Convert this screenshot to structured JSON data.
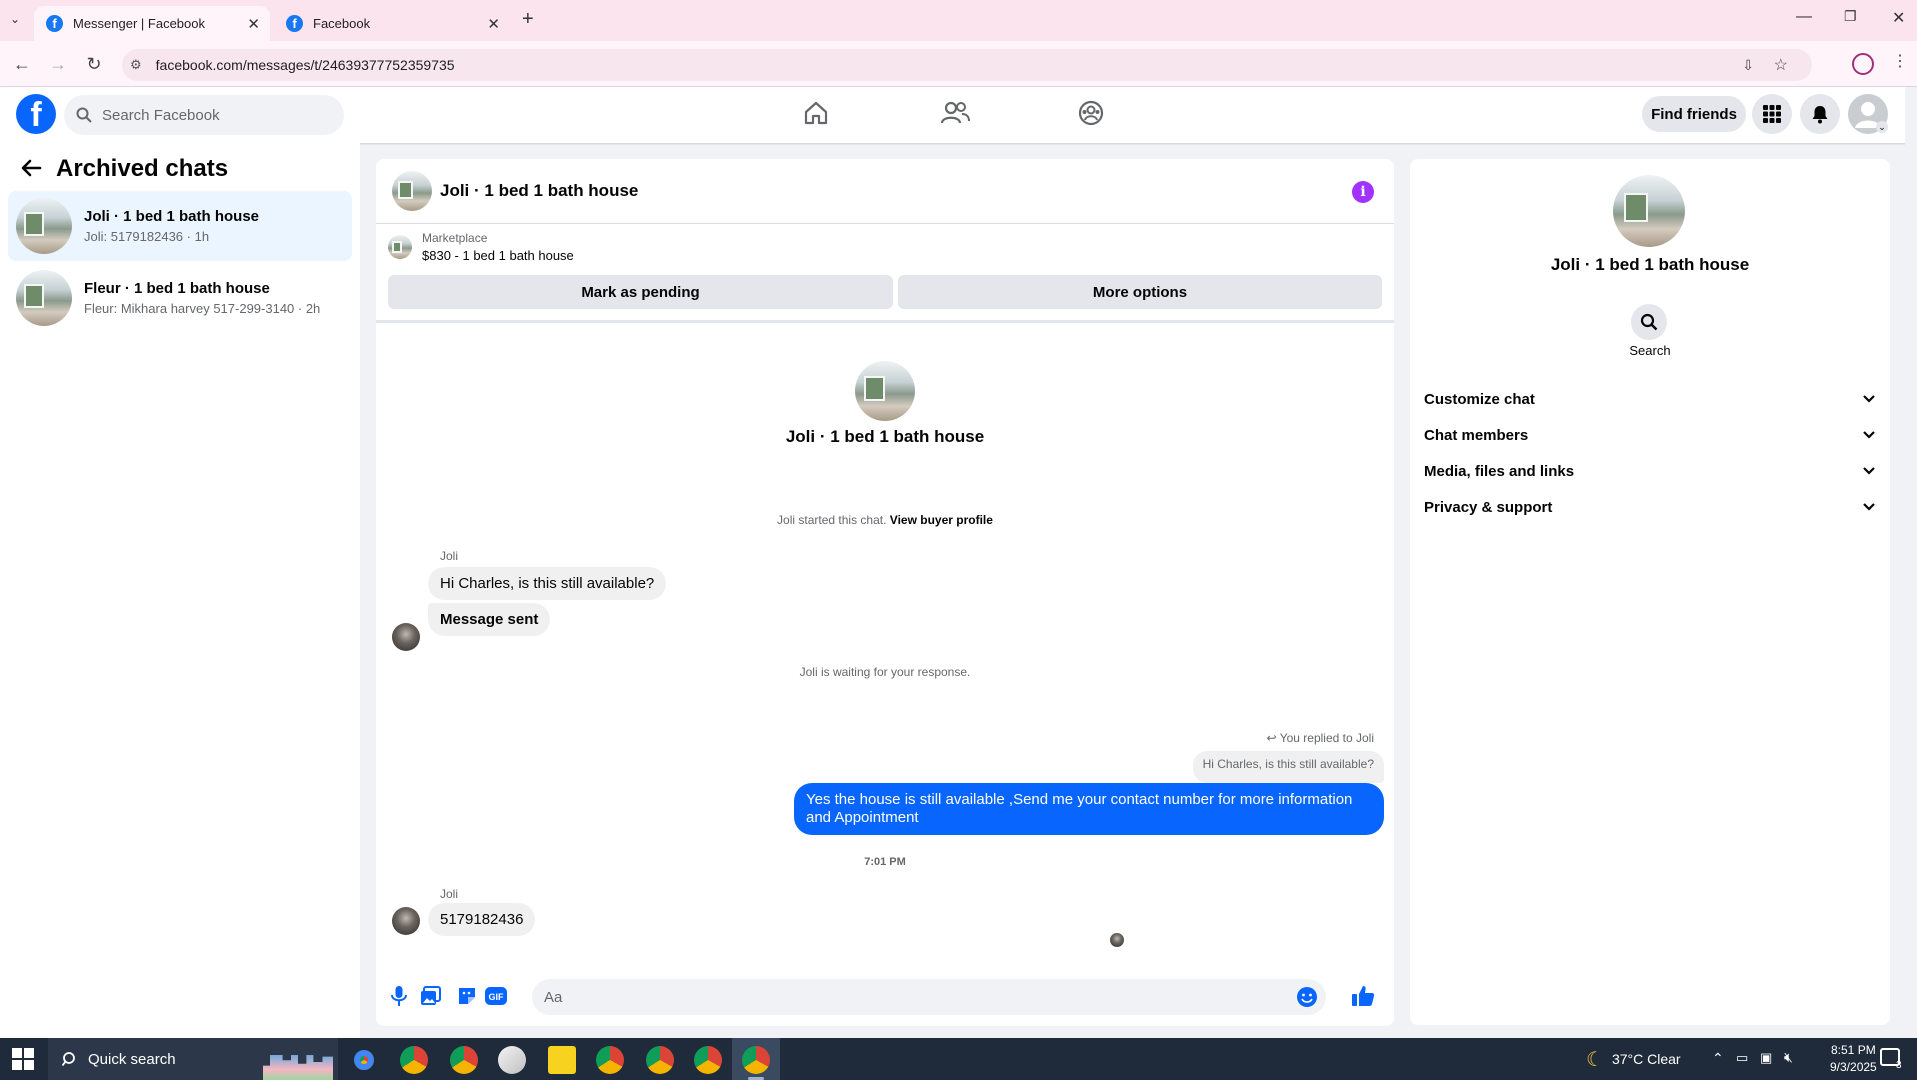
{
  "browser": {
    "tabs": [
      {
        "title": "Messenger | Facebook",
        "active": true
      },
      {
        "title": "Facebook",
        "active": false
      }
    ],
    "url": "facebook.com/messages/t/24639377752359735"
  },
  "fb_header": {
    "search_placeholder": "Search Facebook",
    "find_friends": "Find friends"
  },
  "left_panel": {
    "title": "Archived chats",
    "chats": [
      {
        "name": "Joli · 1 bed 1 bath house",
        "preview": "Joli: 5179182436 · 1h",
        "active": true
      },
      {
        "name": "Fleur · 1 bed 1 bath house",
        "preview": "Fleur: Mikhara harvey 517-299-3140 · 2h",
        "active": false
      }
    ]
  },
  "conversation": {
    "header_title": "Joli · 1 bed 1 bath house",
    "marketplace_label": "Marketplace",
    "listing": "$830 - 1 bed 1 bath house",
    "mark_pending": "Mark as pending",
    "more_options": "More options",
    "title": "Joli · 1 bed 1 bath house",
    "started_text": "Joli started this chat.",
    "view_buyer_profile": "View buyer profile",
    "sender1": "Joli",
    "msg1": "Hi Charles, is this still available?",
    "msg2": "Message sent",
    "waiting_text": "Joli is waiting for your response.",
    "replied_to": "You replied to Joli",
    "quoted_msg": "Hi Charles, is this still available?",
    "my_reply": "Yes the house is still available ,Send me your contact number for more information and Appointment",
    "timestamp": "7:01 PM",
    "sender2": "Joli",
    "msg3": "5179182436",
    "composer_placeholder": "Aa"
  },
  "right_panel": {
    "name": "Joli · 1 bed 1 bath house",
    "search_label": "Search",
    "sections": [
      "Customize chat",
      "Chat members",
      "Media, files and links",
      "Privacy & support"
    ]
  },
  "taskbar": {
    "search": "Quick search",
    "weather": "37°C  Clear",
    "time": "8:51 PM",
    "date": "9/3/2025",
    "notification_count": "3"
  },
  "colors": {
    "fb_blue": "#0866ff",
    "info_purple": "#a033ff",
    "tab_bar": "#fce4ef"
  }
}
